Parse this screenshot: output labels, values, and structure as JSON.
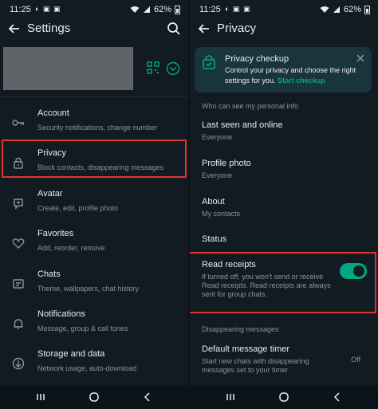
{
  "status_bar": {
    "time": "11:25",
    "battery": "62%"
  },
  "settings": {
    "title": "Settings",
    "items": [
      {
        "title": "Account",
        "subtitle": "Security notifications, change number",
        "icon": "key-icon"
      },
      {
        "title": "Privacy",
        "subtitle": "Block contacts, disappearing messages",
        "icon": "lock-icon"
      },
      {
        "title": "Avatar",
        "subtitle": "Create, edit, profile photo",
        "icon": "avatar-icon"
      },
      {
        "title": "Favorites",
        "subtitle": "Add, reorder, remove",
        "icon": "heart-icon"
      },
      {
        "title": "Chats",
        "subtitle": "Theme, wallpapers, chat history",
        "icon": "chat-icon"
      },
      {
        "title": "Notifications",
        "subtitle": "Message, group & call tones",
        "icon": "bell-icon"
      },
      {
        "title": "Storage and data",
        "subtitle": "Network usage, auto-download",
        "icon": "storage-icon"
      }
    ]
  },
  "privacy": {
    "title": "Privacy",
    "checkup": {
      "title": "Privacy checkup",
      "description": "Control your privacy and choose the right settings for you.",
      "link": "Start checkup"
    },
    "section_personal": "Who can see my personal info",
    "last_seen": {
      "title": "Last seen and online",
      "value": "Everyone"
    },
    "profile_photo": {
      "title": "Profile photo",
      "value": "Everyone"
    },
    "about": {
      "title": "About",
      "value": "My contacts"
    },
    "status": {
      "title": "Status"
    },
    "read_receipts": {
      "title": "Read receipts",
      "description": "If turned off, you won't send or receive Read receipts. Read receipts are always sent for group chats.",
      "enabled": true
    },
    "section_disappearing": "Disappearing messages",
    "default_timer": {
      "title": "Default message timer",
      "description": "Start new chats with disappearing messages set to your timer",
      "value": "Off"
    }
  },
  "colors": {
    "accent": "#00a884",
    "highlight": "#e0342f",
    "background": "#111b21"
  }
}
